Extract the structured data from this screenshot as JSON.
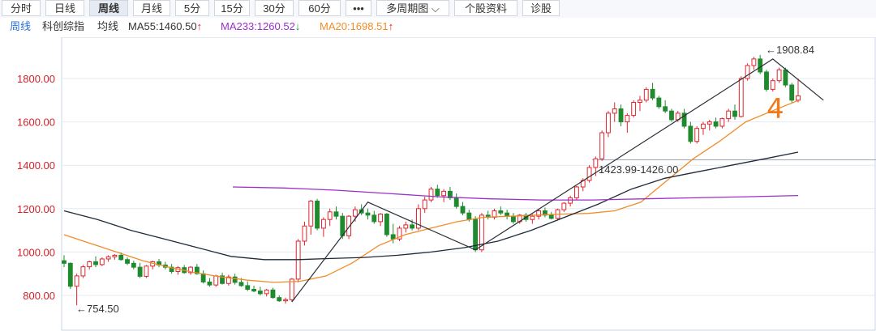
{
  "toolbar": {
    "buttons": [
      "分时",
      "日线",
      "周线",
      "月线",
      "5分",
      "15分",
      "30分",
      "60分",
      "•••",
      "多周期图 ⌵",
      "个股资料",
      "诊股"
    ],
    "active_index": 2
  },
  "legend": {
    "period": "周线",
    "index_name": "科创综指",
    "ma_label": "均线",
    "ma55": "MA55:1460.50",
    "ma233": "MA233:1260.52",
    "ma20": "MA20:1698.51",
    "ma55_arrow": "↑",
    "ma233_arrow": "↓",
    "ma20_arrow": "↑",
    "ma55_color": "#333333",
    "ma233_color": "#9b2fc9",
    "ma20_color": "#f28c28",
    "up_arrow_color": "#e02020",
    "down_arrow_color": "#1a9a3a"
  },
  "chart_data": {
    "type": "candlestick",
    "ylim": [
      720,
      1960
    ],
    "yticks": [
      800,
      1000,
      1200,
      1400,
      1600,
      1800
    ],
    "ytick_labels": [
      "800.00",
      "1000.00",
      "1200.00",
      "1400.00",
      "1600.00",
      "1800.00"
    ],
    "up_color": "#e0262e",
    "down_color": "#1f8a2e",
    "candles": [
      [
        960,
        985,
        930,
        948
      ],
      [
        948,
        952,
        830,
        842
      ],
      [
        842,
        900,
        754.5,
        890
      ],
      [
        890,
        940,
        880,
        932
      ],
      [
        932,
        960,
        920,
        955
      ],
      [
        955,
        980,
        930,
        942
      ],
      [
        942,
        975,
        935,
        968
      ],
      [
        968,
        985,
        955,
        978
      ],
      [
        978,
        990,
        965,
        985
      ],
      [
        985,
        998,
        960,
        965
      ],
      [
        965,
        975,
        940,
        948
      ],
      [
        948,
        960,
        920,
        930
      ],
      [
        930,
        950,
        880,
        888
      ],
      [
        888,
        940,
        880,
        935
      ],
      [
        935,
        960,
        920,
        955
      ],
      [
        955,
        968,
        930,
        940
      ],
      [
        940,
        955,
        920,
        930
      ],
      [
        930,
        945,
        900,
        910
      ],
      [
        910,
        935,
        895,
        928
      ],
      [
        928,
        940,
        900,
        905
      ],
      [
        905,
        935,
        895,
        930
      ],
      [
        930,
        945,
        895,
        900
      ],
      [
        900,
        915,
        855,
        862
      ],
      [
        862,
        880,
        840,
        848
      ],
      [
        848,
        895,
        840,
        890
      ],
      [
        890,
        905,
        850,
        855
      ],
      [
        855,
        895,
        845,
        885
      ],
      [
        885,
        900,
        850,
        860
      ],
      [
        860,
        880,
        840,
        845
      ],
      [
        845,
        865,
        820,
        828
      ],
      [
        828,
        845,
        815,
        820
      ],
      [
        820,
        840,
        800,
        808
      ],
      [
        808,
        830,
        795,
        825
      ],
      [
        825,
        835,
        785,
        790
      ],
      [
        790,
        800,
        770,
        775
      ],
      [
        775,
        790,
        762,
        780
      ],
      [
        780,
        880,
        770,
        875
      ],
      [
        875,
        1060,
        860,
        1050
      ],
      [
        1050,
        1140,
        1030,
        1120
      ],
      [
        1120,
        1240,
        1080,
        1235
      ],
      [
        1235,
        1245,
        1100,
        1110
      ],
      [
        1110,
        1160,
        1070,
        1150
      ],
      [
        1150,
        1200,
        1120,
        1185
      ],
      [
        1185,
        1210,
        1150,
        1165
      ],
      [
        1165,
        1180,
        1060,
        1075
      ],
      [
        1075,
        1170,
        1060,
        1165
      ],
      [
        1165,
        1210,
        1140,
        1195
      ],
      [
        1195,
        1220,
        1170,
        1180
      ],
      [
        1180,
        1200,
        1150,
        1170
      ],
      [
        1170,
        1190,
        1130,
        1140
      ],
      [
        1140,
        1180,
        1120,
        1175
      ],
      [
        1175,
        1180,
        1070,
        1080
      ],
      [
        1080,
        1130,
        1040,
        1060
      ],
      [
        1060,
        1120,
        1050,
        1110
      ],
      [
        1110,
        1140,
        1090,
        1125
      ],
      [
        1125,
        1150,
        1100,
        1110
      ],
      [
        1110,
        1220,
        1100,
        1200
      ],
      [
        1200,
        1255,
        1180,
        1240
      ],
      [
        1240,
        1300,
        1230,
        1290
      ],
      [
        1290,
        1310,
        1250,
        1260
      ],
      [
        1260,
        1290,
        1230,
        1280
      ],
      [
        1280,
        1300,
        1240,
        1250
      ],
      [
        1250,
        1270,
        1200,
        1210
      ],
      [
        1210,
        1230,
        1170,
        1180
      ],
      [
        1180,
        1195,
        1140,
        1150
      ],
      [
        1150,
        1165,
        1000,
        1010
      ],
      [
        1010,
        1180,
        1000,
        1170
      ],
      [
        1170,
        1190,
        1150,
        1160
      ],
      [
        1160,
        1200,
        1150,
        1190
      ],
      [
        1190,
        1210,
        1170,
        1180
      ],
      [
        1180,
        1195,
        1150,
        1165
      ],
      [
        1165,
        1180,
        1130,
        1140
      ],
      [
        1140,
        1175,
        1130,
        1170
      ],
      [
        1170,
        1180,
        1140,
        1150
      ],
      [
        1150,
        1175,
        1130,
        1165
      ],
      [
        1165,
        1200,
        1150,
        1190
      ],
      [
        1190,
        1205,
        1160,
        1170
      ],
      [
        1170,
        1185,
        1150,
        1155
      ],
      [
        1155,
        1200,
        1145,
        1195
      ],
      [
        1195,
        1230,
        1185,
        1225
      ],
      [
        1225,
        1260,
        1210,
        1250
      ],
      [
        1250,
        1305,
        1240,
        1300
      ],
      [
        1300,
        1340,
        1280,
        1330
      ],
      [
        1330,
        1400,
        1320,
        1390
      ],
      [
        1390,
        1440,
        1350,
        1430
      ],
      [
        1430,
        1560,
        1420,
        1550
      ],
      [
        1550,
        1650,
        1530,
        1640
      ],
      [
        1640,
        1690,
        1600,
        1660
      ],
      [
        1660,
        1680,
        1580,
        1600
      ],
      [
        1600,
        1640,
        1550,
        1630
      ],
      [
        1630,
        1700,
        1620,
        1690
      ],
      [
        1690,
        1720,
        1650,
        1700
      ],
      [
        1700,
        1760,
        1690,
        1750
      ],
      [
        1750,
        1780,
        1700,
        1710
      ],
      [
        1710,
        1720,
        1660,
        1670
      ],
      [
        1670,
        1700,
        1640,
        1650
      ],
      [
        1650,
        1660,
        1600,
        1610
      ],
      [
        1610,
        1650,
        1600,
        1640
      ],
      [
        1640,
        1660,
        1570,
        1580
      ],
      [
        1580,
        1600,
        1500,
        1510
      ],
      [
        1510,
        1580,
        1500,
        1570
      ],
      [
        1570,
        1600,
        1540,
        1590
      ],
      [
        1590,
        1610,
        1560,
        1600
      ],
      [
        1600,
        1620,
        1570,
        1580
      ],
      [
        1580,
        1620,
        1570,
        1615
      ],
      [
        1615,
        1660,
        1600,
        1650
      ],
      [
        1650,
        1680,
        1610,
        1625
      ],
      [
        1625,
        1810,
        1620,
        1800
      ],
      [
        1800,
        1870,
        1790,
        1860
      ],
      [
        1860,
        1900,
        1840,
        1890
      ],
      [
        1890,
        1908.84,
        1820,
        1830
      ],
      [
        1830,
        1840,
        1740,
        1750
      ],
      [
        1750,
        1800,
        1740,
        1790
      ],
      [
        1790,
        1850,
        1780,
        1840
      ],
      [
        1840,
        1850,
        1760,
        1770
      ],
      [
        1770,
        1780,
        1690,
        1700
      ],
      [
        1700,
        1800,
        1690,
        1720
      ]
    ],
    "ma20": [
      1080,
      1040,
      1000,
      960,
      930,
      905,
      885,
      870,
      860,
      865,
      890,
      950,
      1030,
      1080,
      1110,
      1140,
      1160,
      1165,
      1170,
      1175,
      1178,
      1190,
      1230,
      1330,
      1430,
      1510,
      1600,
      1650,
      1698.51
    ],
    "ma55": [
      1190,
      1150,
      1100,
      1060,
      1020,
      980,
      965,
      965,
      970,
      975,
      985,
      1000,
      1020,
      1050,
      1100,
      1160,
      1220,
      1290,
      1340,
      1370,
      1400,
      1430,
      1460.5
    ],
    "ma233": [
      1300,
      1295,
      1285,
      1270,
      1255,
      1245,
      1240,
      1240,
      1245,
      1250,
      1255,
      1260.52
    ],
    "annotations": {
      "high_label": "←1908.84",
      "low_label": "←754.50",
      "range_label": "1423.99-1426.00",
      "wave_label": "4"
    }
  }
}
